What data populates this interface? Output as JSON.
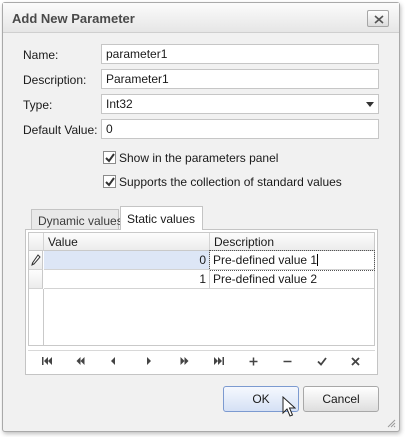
{
  "dialog": {
    "title": "Add New Parameter"
  },
  "form": {
    "name_label": "Name:",
    "name_value": "parameter1",
    "description_label": "Description:",
    "description_value": "Parameter1",
    "type_label": "Type:",
    "type_value": "Int32",
    "default_value_label": "Default Value:",
    "default_value_value": "0",
    "show_in_panel_label": "Show in the parameters panel",
    "show_in_panel_checked": true,
    "supports_collection_label": "Supports the collection of standard values",
    "supports_collection_checked": true
  },
  "tabs": {
    "dynamic_label": "Dynamic values",
    "static_label": "Static values",
    "active": "Static values"
  },
  "grid": {
    "columns": [
      "Value",
      "Description"
    ],
    "rows": [
      {
        "value": "0",
        "description": "Pre-defined value 1"
      },
      {
        "value": "1",
        "description": "Pre-defined value 2"
      }
    ]
  },
  "navigator": {
    "icons": [
      "first-icon",
      "prev-page-icon",
      "prev-icon",
      "next-icon",
      "next-page-icon",
      "last-icon",
      "append-icon",
      "remove-icon",
      "end-edit-icon",
      "cancel-edit-icon"
    ]
  },
  "buttons": {
    "ok_label": "OK",
    "cancel_label": "Cancel"
  },
  "colors": {
    "focused_row": "#dde6f6",
    "ok_border": "#7c9ad0"
  }
}
